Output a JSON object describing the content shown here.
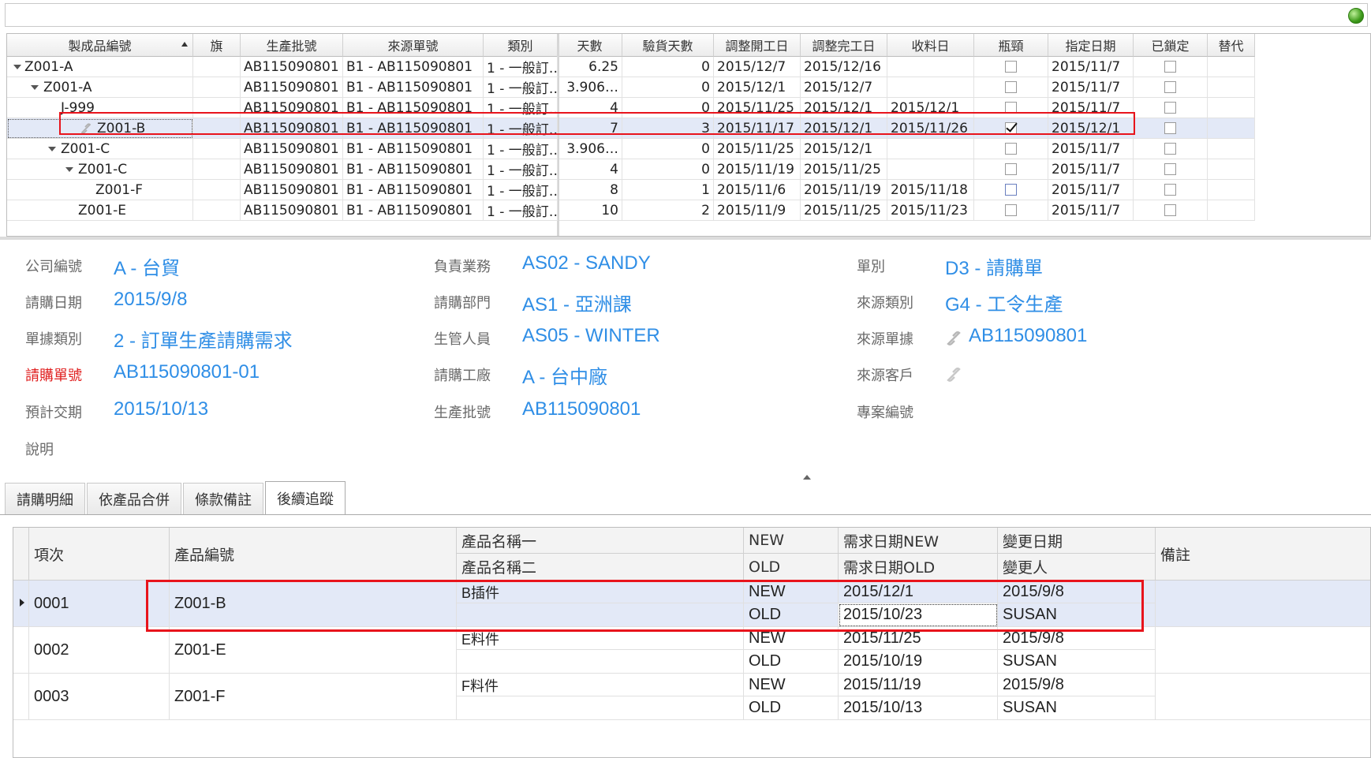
{
  "top_grid": {
    "headers": [
      "製成品編號",
      "旗",
      "生產批號",
      "來源單號",
      "類別",
      "天數",
      "驗貨天數",
      "調整開工日",
      "調整完工日",
      "收料日",
      "瓶頸",
      "指定日期",
      "已鎖定",
      "替代"
    ],
    "rows": [
      {
        "name": "Z001-A",
        "lot": "AB115090801",
        "src": "B1 - AB115090801",
        "type": "1 - 一般訂…",
        "days": "6.25",
        "insp": "0",
        "start": "2015/12/7",
        "end": "2015/12/16",
        "recv": "",
        "bottleneck": false,
        "assigned": "2015/11/7"
      },
      {
        "name": "Z001-A",
        "lot": "AB115090801",
        "src": "B1 - AB115090801",
        "type": "1 - 一般訂…",
        "days": "3.906…",
        "insp": "0",
        "start": "2015/12/1",
        "end": "2015/12/7",
        "recv": "",
        "bottleneck": false,
        "assigned": "2015/11/7"
      },
      {
        "name": "J-999",
        "lot": "AB115090801",
        "src": "B1 - AB115090801",
        "type": "1 - 一般訂…",
        "days": "4",
        "insp": "0",
        "start": "2015/11/25",
        "end": "2015/12/1",
        "recv": "2015/12/1",
        "bottleneck": false,
        "assigned": "2015/11/7"
      },
      {
        "name": "Z001-B",
        "lot": "AB115090801",
        "src": "B1 - AB115090801",
        "type": "1 - 一般訂…",
        "days": "7",
        "insp": "3",
        "start": "2015/11/17",
        "end": "2015/12/1",
        "recv": "2015/11/26",
        "bottleneck": true,
        "assigned": "2015/12/1"
      },
      {
        "name": "Z001-C",
        "lot": "AB115090801",
        "src": "B1 - AB115090801",
        "type": "1 - 一般訂…",
        "days": "3.906…",
        "insp": "0",
        "start": "2015/11/25",
        "end": "2015/12/1",
        "recv": "",
        "bottleneck": false,
        "assigned": "2015/11/7"
      },
      {
        "name": "Z001-C",
        "lot": "AB115090801",
        "src": "B1 - AB115090801",
        "type": "1 - 一般訂…",
        "days": "4",
        "insp": "0",
        "start": "2015/11/19",
        "end": "2015/11/25",
        "recv": "",
        "bottleneck": false,
        "assigned": "2015/11/7"
      },
      {
        "name": "Z001-F",
        "lot": "AB115090801",
        "src": "B1 - AB115090801",
        "type": "1 - 一般訂…",
        "days": "8",
        "insp": "1",
        "start": "2015/11/6",
        "end": "2015/11/19",
        "recv": "2015/11/18",
        "bottleneck": false,
        "assigned": "2015/11/7"
      },
      {
        "name": "Z001-E",
        "lot": "AB115090801",
        "src": "B1 - AB115090801",
        "type": "1 - 一般訂…",
        "days": "10",
        "insp": "2",
        "start": "2015/11/9",
        "end": "2015/11/25",
        "recv": "2015/11/23",
        "bottleneck": false,
        "assigned": "2015/11/7"
      }
    ]
  },
  "form": {
    "company_label": "公司編號",
    "company": "A - 台貿",
    "req_date_label": "請購日期",
    "req_date": "2015/9/8",
    "doc_class_label": "單據類別",
    "doc_class": "2 - 訂單生產請購需求",
    "req_no_label": "請購單號",
    "req_no": "AB115090801-01",
    "eta_label": "預計交期",
    "eta": "2015/10/13",
    "desc_label": "說明",
    "sales_label": "負責業務",
    "sales": "AS02 - SANDY",
    "dept_label": "請購部門",
    "dept": "AS1 - 亞洲課",
    "pm_label": "生管人員",
    "pm": "AS05 - WINTER",
    "factory_label": "請購工廠",
    "factory": "A - 台中廠",
    "lot_label": "生產批號",
    "lot": "AB115090801",
    "doc_type_label": "單別",
    "doc_type": "D3 - 請購單",
    "src_type_label": "來源類別",
    "src_type": "G4 - 工令生產",
    "src_doc_label": "來源單據",
    "src_doc": "AB115090801",
    "src_cust_label": "來源客戶",
    "project_label": "專案編號"
  },
  "tabs": [
    "請購明細",
    "依產品合併",
    "條款備註",
    "後續追蹤"
  ],
  "bottom_grid": {
    "h_item": "項次",
    "h_product": "產品編號",
    "h_name1": "產品名稱一",
    "h_name2": "產品名稱二",
    "h_new": "NEW",
    "h_old": "OLD",
    "h_req_new": "需求日期NEW",
    "h_req_old": "需求日期OLD",
    "h_chg_date": "變更日期",
    "h_chg_by": "變更人",
    "h_note": "備註",
    "rows": [
      {
        "item": "0001",
        "product": "Z001-B",
        "name1": "B插件",
        "name2": "",
        "new": "NEW",
        "old": "OLD",
        "req_new": "2015/12/1",
        "req_old": "2015/10/23",
        "chg_date": "2015/9/8",
        "chg_by": "SUSAN"
      },
      {
        "item": "0002",
        "product": "Z001-E",
        "name1": "E料件",
        "name2": "",
        "new": "NEW",
        "old": "OLD",
        "req_new": "2015/11/25",
        "req_old": "2015/10/19",
        "chg_date": "2015/9/8",
        "chg_by": "SUSAN"
      },
      {
        "item": "0003",
        "product": "Z001-F",
        "name1": "F料件",
        "name2": "",
        "new": "NEW",
        "old": "OLD",
        "req_new": "2015/11/19",
        "req_old": "2015/10/13",
        "chg_date": "2015/9/8",
        "chg_by": "SUSAN"
      }
    ]
  }
}
